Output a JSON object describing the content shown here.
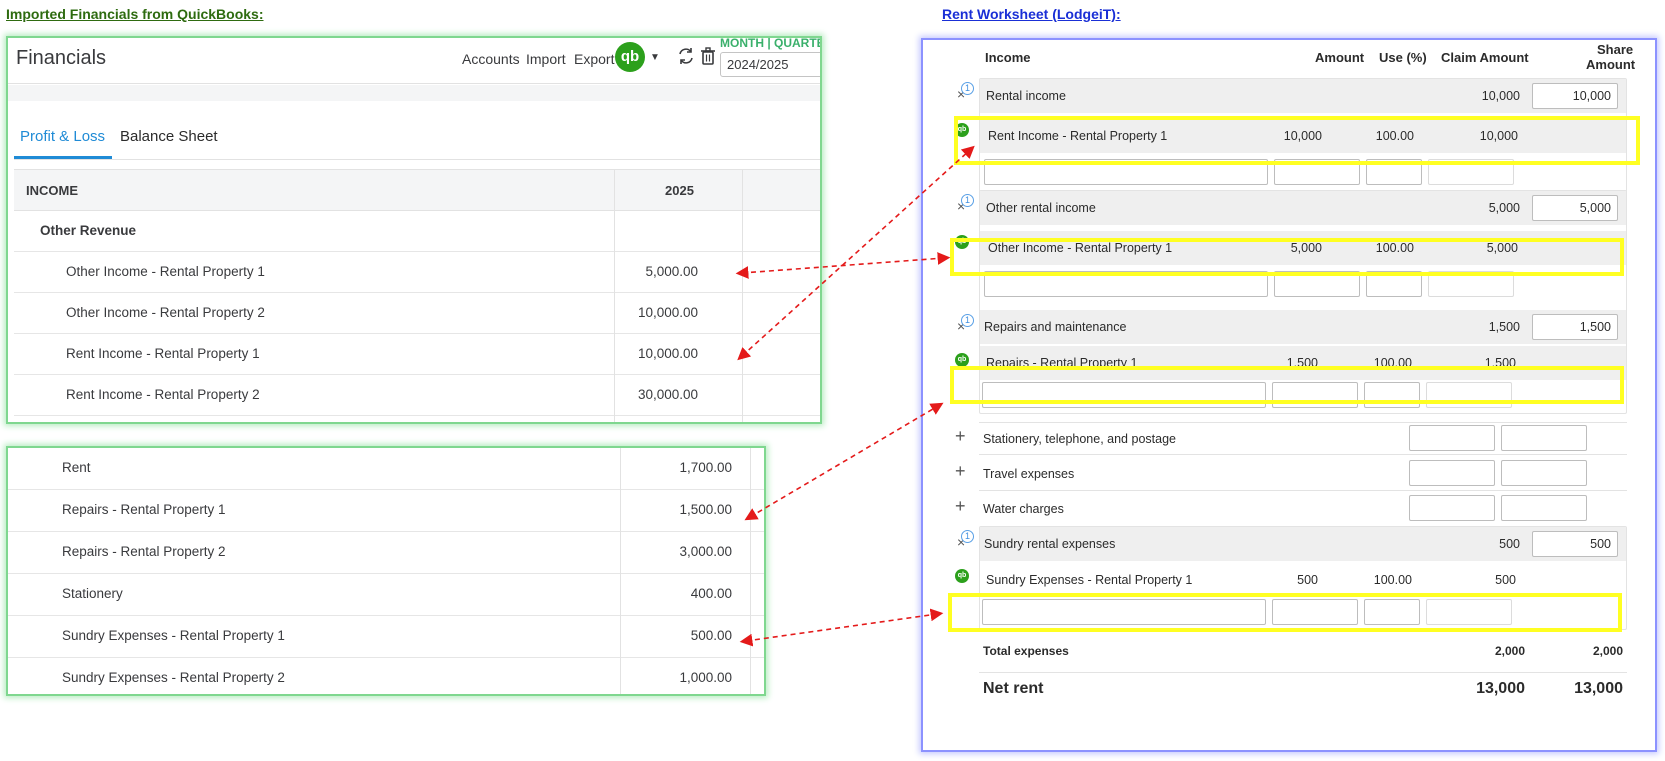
{
  "captions": {
    "quickbooks": "Imported Financials from QuickBooks:",
    "lodgeit": "Rent Worksheet (LodgeiT):"
  },
  "qb": {
    "title": "Financials",
    "links": [
      "Accounts",
      "Import",
      "Export"
    ],
    "logo_text": "qb",
    "period_label": "MONTH | QUARTE",
    "year_value": "2024/2025",
    "tabs": [
      "Profit & Loss",
      "Balance Sheet"
    ],
    "income_header": "INCOME",
    "year_header": "2025",
    "group": "Other Revenue",
    "rows": [
      {
        "name": "Other Income - Rental Property 1",
        "value": "5,000.00"
      },
      {
        "name": "Other Income - Rental Property 2",
        "value": "10,000.00"
      },
      {
        "name": "Rent Income - Rental Property 1",
        "value": "10,000.00"
      },
      {
        "name": "Rent Income - Rental Property 2",
        "value": "30,000.00"
      }
    ],
    "expense_rows": [
      {
        "name": "Rent",
        "value": "1,700.00"
      },
      {
        "name": "Repairs - Rental Property 1",
        "value": "1,500.00"
      },
      {
        "name": "Repairs - Rental Property 2",
        "value": "3,000.00"
      },
      {
        "name": "Stationery",
        "value": "400.00"
      },
      {
        "name": "Sundry Expenses - Rental Property 1",
        "value": "500.00"
      },
      {
        "name": "Sundry Expenses - Rental Property 2",
        "value": "1,000.00"
      }
    ]
  },
  "lodgeit": {
    "headers": {
      "income": "Income",
      "amount": "Amount",
      "use": "Use (%)",
      "claim": "Claim Amount",
      "share_1": "Share",
      "share_2": "Amount"
    },
    "badge": "1",
    "qb_badge": "qb",
    "remove_glyph": "×",
    "add_glyph": "+",
    "rental_income": {
      "label": "Rental income",
      "claim": "10,000",
      "share": "10,000",
      "sub": {
        "label": "Rent Income - Rental Property 1",
        "amount": "10,000",
        "use": "100.00",
        "claim": "10,000"
      }
    },
    "other_income": {
      "label": "Other rental income",
      "claim": "5,000",
      "share": "5,000",
      "sub": {
        "label": "Other Income - Rental Property 1",
        "amount": "5,000",
        "use": "100.00",
        "claim": "5,000"
      }
    },
    "repairs": {
      "label": "Repairs and maintenance",
      "claim": "1,500",
      "share": "1,500",
      "sub": {
        "label": "Repairs - Rental Property 1",
        "amount": "1,500",
        "use": "100.00",
        "claim": "1,500"
      }
    },
    "plain_rows": [
      "Stationery, telephone, and postage",
      "Travel expenses",
      "Water charges"
    ],
    "sundry": {
      "label": "Sundry rental expenses",
      "claim": "500",
      "share": "500",
      "sub": {
        "label": "Sundry Expenses - Rental Property 1",
        "amount": "500",
        "use": "100.00",
        "claim": "500"
      }
    },
    "total_expenses": {
      "label": "Total expenses",
      "claim": "2,000",
      "share": "2,000"
    },
    "net_rent": {
      "label": "Net rent",
      "claim": "13,000",
      "share": "13,000"
    }
  },
  "colors": {
    "qb_green": "#2ca01c",
    "qb_blue_tab": "#1f8bd6",
    "highlight_yellow": "#ffff22",
    "arrow_red": "#e41a1a",
    "qb_frame": "#7fd78f",
    "lodgeit_frame": "#8c92ff"
  }
}
